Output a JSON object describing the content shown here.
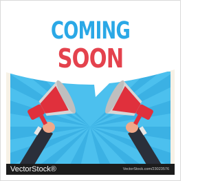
{
  "headline": {
    "line_1": "COMING",
    "line_2": "SOON"
  },
  "watermark": {
    "brand": "VectorStock®",
    "image_ref": "VectorStock.com/23023576"
  },
  "colors": {
    "background": "#f6f1e6",
    "bubble": "#ffffff",
    "line_1": "#2aa8e6",
    "line_2": "#e4424d",
    "burst_light": "#4cc0ee",
    "burst_dark": "#2ea6dd",
    "megaphone_red": "#e0303c",
    "megaphone_grey": "#d6d6d6",
    "sleeve": "#2a2f3a",
    "skin": "#f0a98a",
    "footer": "#1c1c1c"
  },
  "icons": {
    "left": "megaphone-left-icon",
    "right": "megaphone-right-icon"
  }
}
